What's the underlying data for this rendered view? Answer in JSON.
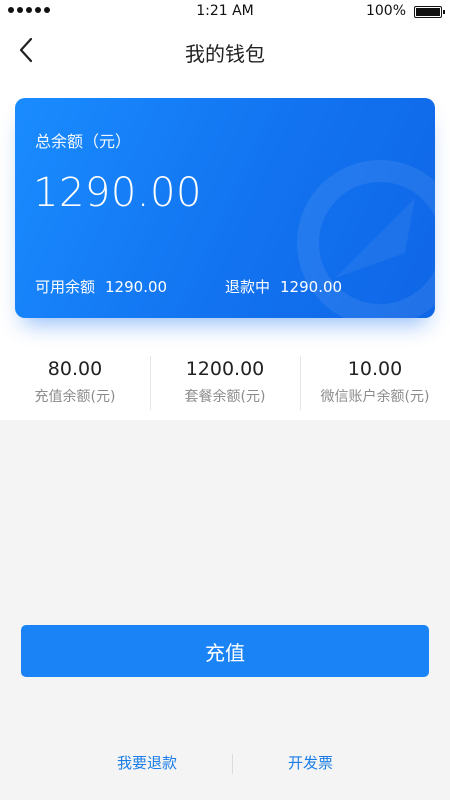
{
  "status_bar": {
    "time": "1:21 AM",
    "battery": "100%"
  },
  "nav": {
    "title": "我的钱包"
  },
  "card": {
    "total_label": "总余额（元）",
    "total_amount": "1290.00",
    "available_label": "可用余额",
    "available_value": "1290.00",
    "refunding_label": "退款中",
    "refunding_value": "1290.00"
  },
  "stats": [
    {
      "value": "80.00",
      "label": "充值余额(元)"
    },
    {
      "value": "1200.00",
      "label": "套餐余额(元)"
    },
    {
      "value": "10.00",
      "label": "微信账户余额(元)"
    }
  ],
  "actions": {
    "recharge": "充值"
  },
  "links": {
    "refund": "我要退款",
    "invoice": "开发票"
  },
  "colors": {
    "accent": "#1a84f7",
    "card_start": "#1a8cff",
    "card_end": "#0f66e6",
    "link": "#1a7de8"
  }
}
